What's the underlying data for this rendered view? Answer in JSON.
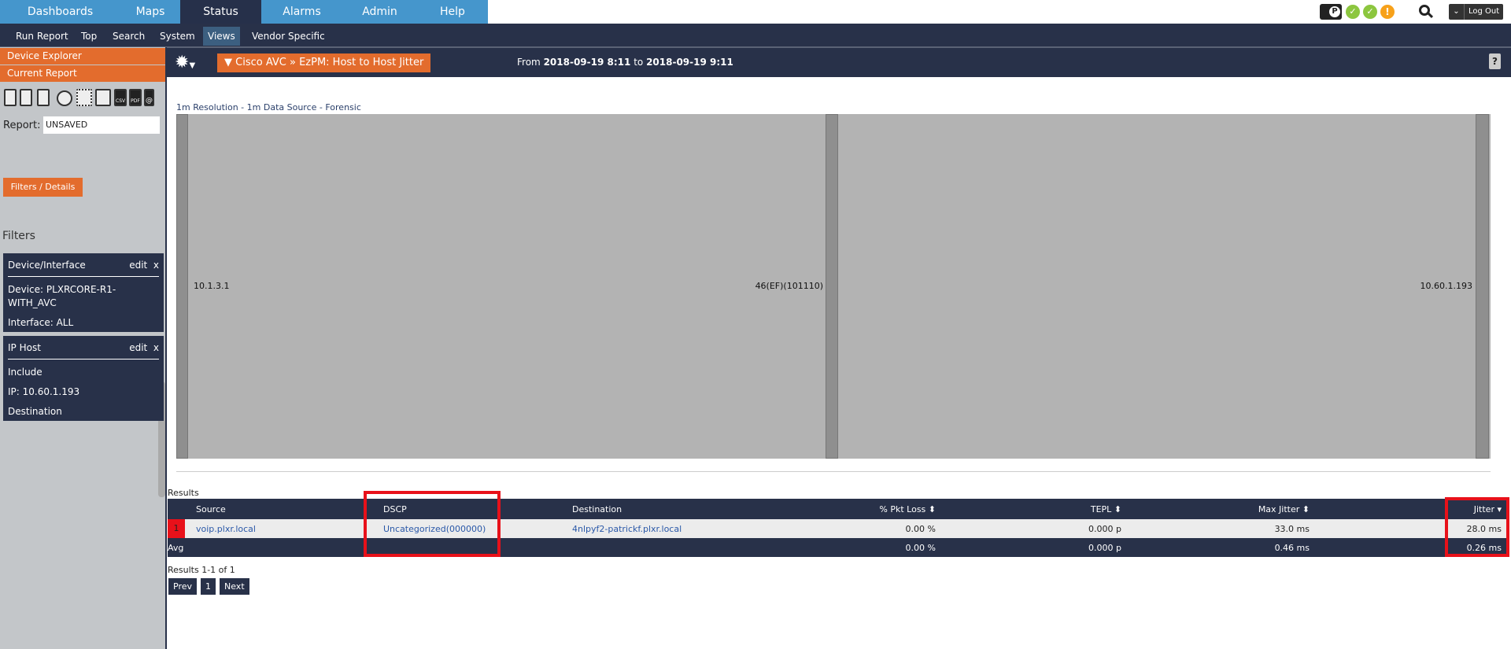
{
  "top_nav": {
    "tabs": [
      "Dashboards",
      "Maps",
      "Status",
      "Alarms",
      "Admin",
      "Help"
    ],
    "active": "Status",
    "logout_label": "Log Out"
  },
  "sub_nav": {
    "items": [
      "Run Report",
      "Top",
      "Search",
      "System",
      "Views",
      "Vendor Specific"
    ],
    "active": "Views"
  },
  "sidebar": {
    "device_explorer": "Device Explorer",
    "current_report": "Current Report",
    "report_label": "Report:",
    "report_value": "UNSAVED",
    "filters_button": "Filters / Details",
    "filters_heading": "Filters",
    "toolbar_icons": [
      "trash-icon",
      "save-icon",
      "save-as-icon",
      "clock-icon",
      "layout-icon",
      "print-icon",
      "csv-icon",
      "pdf-icon",
      "email-icon"
    ],
    "csv": "CSV",
    "pdf": "PDF",
    "at": "@",
    "filters": [
      {
        "title": "Device/Interface",
        "edit": "edit",
        "close": "x",
        "lines": [
          "Device: PLXRCORE-R1-WITH_AVC",
          "Interface: ALL"
        ]
      },
      {
        "title": "IP Host",
        "edit": "edit",
        "close": "x",
        "lines": [
          "Include",
          "IP: 10.60.1.193",
          "Destination"
        ]
      }
    ]
  },
  "header": {
    "report_title": "▼ Cisco AVC » EzPM: Host to Host Jitter",
    "from_label": "From",
    "from": "2018-09-19 8:11",
    "to_label": "to",
    "to": "2018-09-19 9:11",
    "help": "?"
  },
  "chart": {
    "subtitle": "1m Resolution - 1m Data Source - Forensic",
    "nodes": [
      "10.1.3.1",
      "46(EF)(101110)",
      "10.60.1.193"
    ]
  },
  "results": {
    "label": "Results",
    "columns": [
      "Source",
      "DSCP",
      "Destination",
      "% Pkt Loss",
      "TEPL",
      "Max Jitter",
      "Jitter"
    ],
    "rows": [
      {
        "index": "1",
        "source": "voip.plxr.local",
        "dscp": "Uncategorized(000000)",
        "destination": "4nlpyf2-patrickf.plxr.local",
        "pkt_loss": "0.00 %",
        "tepl": "0.000 p",
        "max_jitter": "33.0 ms",
        "jitter": "28.0 ms"
      }
    ],
    "avg": {
      "label": "Avg",
      "pkt_loss": "0.00 %",
      "tepl": "0.000 p",
      "max_jitter": "0.46 ms",
      "jitter": "0.26 ms"
    },
    "summary": "Results 1-1 of 1",
    "pagination": {
      "prev": "Prev",
      "page": "1",
      "next": "Next"
    }
  },
  "colors": {
    "nav_blue": "#4596cc",
    "navy": "#283149",
    "orange": "#e36c2d",
    "highlight_red": "#e8111a",
    "status_green": "#8cc63f",
    "status_orange": "#f7a11a"
  }
}
